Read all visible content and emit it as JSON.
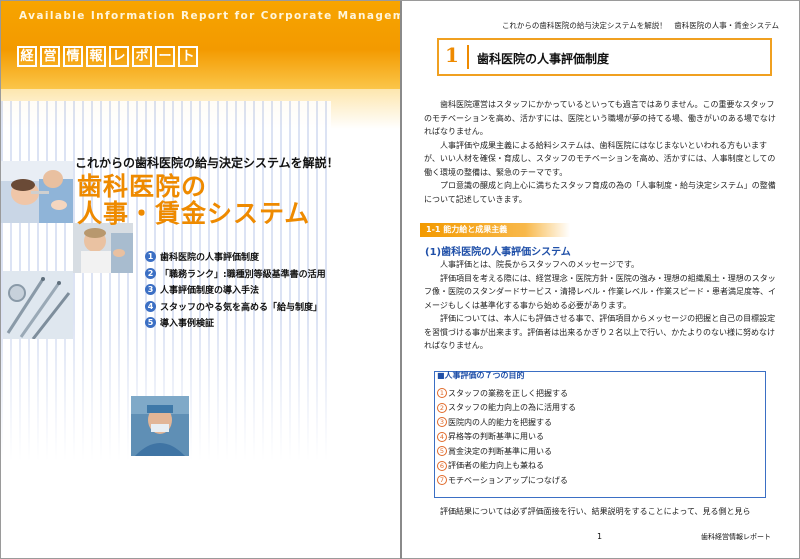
{
  "cover": {
    "eng_title": "Available Information Report for Corporate Management",
    "logo_chars": [
      "経",
      "営",
      "情",
      "報",
      "レ",
      "ポ",
      "ー",
      "ト"
    ],
    "lead": "これからの歯科医院の給与決定システムを解説！",
    "title_line1": "歯科医院の",
    "title_line2": "人事・賃金システム",
    "toc": [
      {
        "num": "1",
        "label": "歯科医院の人事評価制度"
      },
      {
        "num": "2",
        "label": "「職務ランク」:職種別等級基準書の活用"
      },
      {
        "num": "3",
        "label": "人事評価制度の導入手法"
      },
      {
        "num": "4",
        "label": "スタッフのやる気を高める「給与制度」"
      },
      {
        "num": "5",
        "label": "導入事例検証"
      }
    ]
  },
  "page": {
    "running_head": "これからの歯科医院の給与決定システムを解説！　歯科医院の人事・賃金システム",
    "section_num": "1",
    "section_title": "歯科医院の人事評価制度",
    "intro": [
      "歯科医院運営はスタッフにかかっているといっても過言ではありません。この重要なスタッフのモチベーションを高め、活かすには、医院という職場が夢の持てる場、働きがいのある場でなければなりません。",
      "人事評価や成果主義による給料システムは、歯科医院にはなじまないといわれる方もいますが、いい人材を確保・育成し、スタッフのモチベーションを高め、活かすには、人事制度としての働く環境の整備は、緊急のテーマです。",
      "プロ意識の醸成と向上心に満ちたスタッフ育成の為の「人事制度・給与決定システム」の整備について記述していきます。"
    ],
    "subsection_label": "1-1 能力給と成果主義",
    "heading": "(1)歯科医院の人事評価システム",
    "body": [
      "人事評価とは、院長からスタッフへのメッセージです。",
      "評価項目を考える際には、経営理念・医院方針・医院の強み・理想の組織風土・理想のスタッフ像・医院のスタンダードサービス・清掃レベル・作業レベル・作業スピード・患者満足度等、イメージもしくは基準化する事から始める必要があります。",
      "評価については、本人にも評価させる事で、評価項目からメッセージの把握と自己の目標設定を習慣づける事が出来ます。評価者は出来るかぎり２名以上で行い、かたよりのない様に努めなければなりません。"
    ],
    "goals_title": "■人事評価の７つの目的",
    "goals": [
      {
        "num": "1",
        "text": "スタッフの業務を正しく把握する"
      },
      {
        "num": "2",
        "text": "スタッフの能力向上の為に活用する"
      },
      {
        "num": "3",
        "text": "医院内の人的能力を把握する"
      },
      {
        "num": "4",
        "text": "昇格等の判断基準に用いる"
      },
      {
        "num": "5",
        "text": "賞金決定の判断基準に用いる"
      },
      {
        "num": "6",
        "text": "評価者の能力向上も兼ねる"
      },
      {
        "num": "7",
        "text": "モチベーションアップにつなげる"
      }
    ],
    "closing": "評価結果については必ず評価面接を行い、結果説明をすることによって、見る側と見ら",
    "page_number": "1",
    "footer": "歯科経営情報レポート"
  },
  "colors": {
    "accent": "#f39a00",
    "blue": "#3b6fc4",
    "heading_blue": "#1f4fa8"
  }
}
